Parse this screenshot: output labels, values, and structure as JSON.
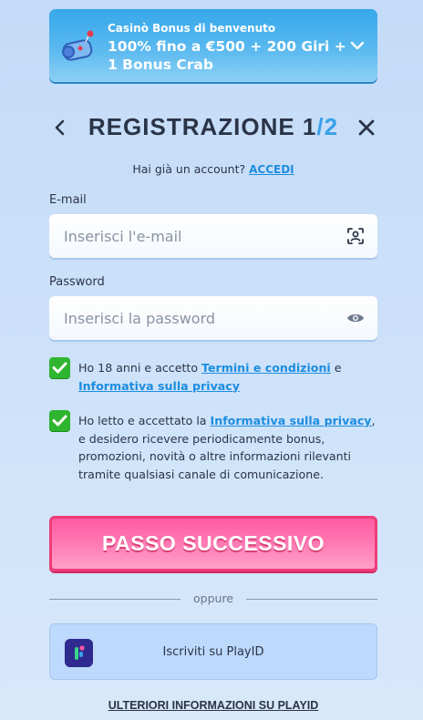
{
  "bonus": {
    "kicker": "Casinò Bonus di benvenuto",
    "title": "100% fino a €500 + 200 Giri + 1 Bonus Crab",
    "icon": "gift-scroll-icon"
  },
  "registration": {
    "title_main": "REGISTRAZIONE 1",
    "title_step": "/2"
  },
  "login_prompt": {
    "text": "Hai già un account? ",
    "link": "ACCEDI"
  },
  "email": {
    "label": "E-mail",
    "placeholder": "Inserisci l'e-mail",
    "value": "",
    "icon": "user-scan-icon"
  },
  "password": {
    "label": "Password",
    "placeholder": "Inserisci la password",
    "value": "",
    "icon": "eye-icon"
  },
  "consent_terms": {
    "checked": true,
    "text_1": "Ho 18 anni e accetto ",
    "link_terms": "Termini e condizioni",
    "text_2": " e ",
    "link_privacy": "Informativa sulla privacy"
  },
  "consent_marketing": {
    "checked": true,
    "text_1": "Ho letto e accettato la ",
    "link_privacy": "Informativa sulla privacy",
    "text_2": ", e desidero ricevere periodicamente bonus, promozioni, novità o altre informazioni rilevanti tramite qualsiasi canale di comunicazione."
  },
  "next_button": {
    "label": "PASSO SUCCESSIVO"
  },
  "divider": {
    "text": "oppure"
  },
  "playid": {
    "label": "Iscriviti su PlayID"
  },
  "more_info": {
    "label": "ULTERIORI INFORMAZIONI SU PLAYID"
  },
  "colors": {
    "background": "#cfe3fa",
    "accent_link": "#1d8de0",
    "banner_blue": "#36a8ea",
    "cta_pink": "#ff5aa0",
    "checkbox_green": "#2fb52f"
  }
}
